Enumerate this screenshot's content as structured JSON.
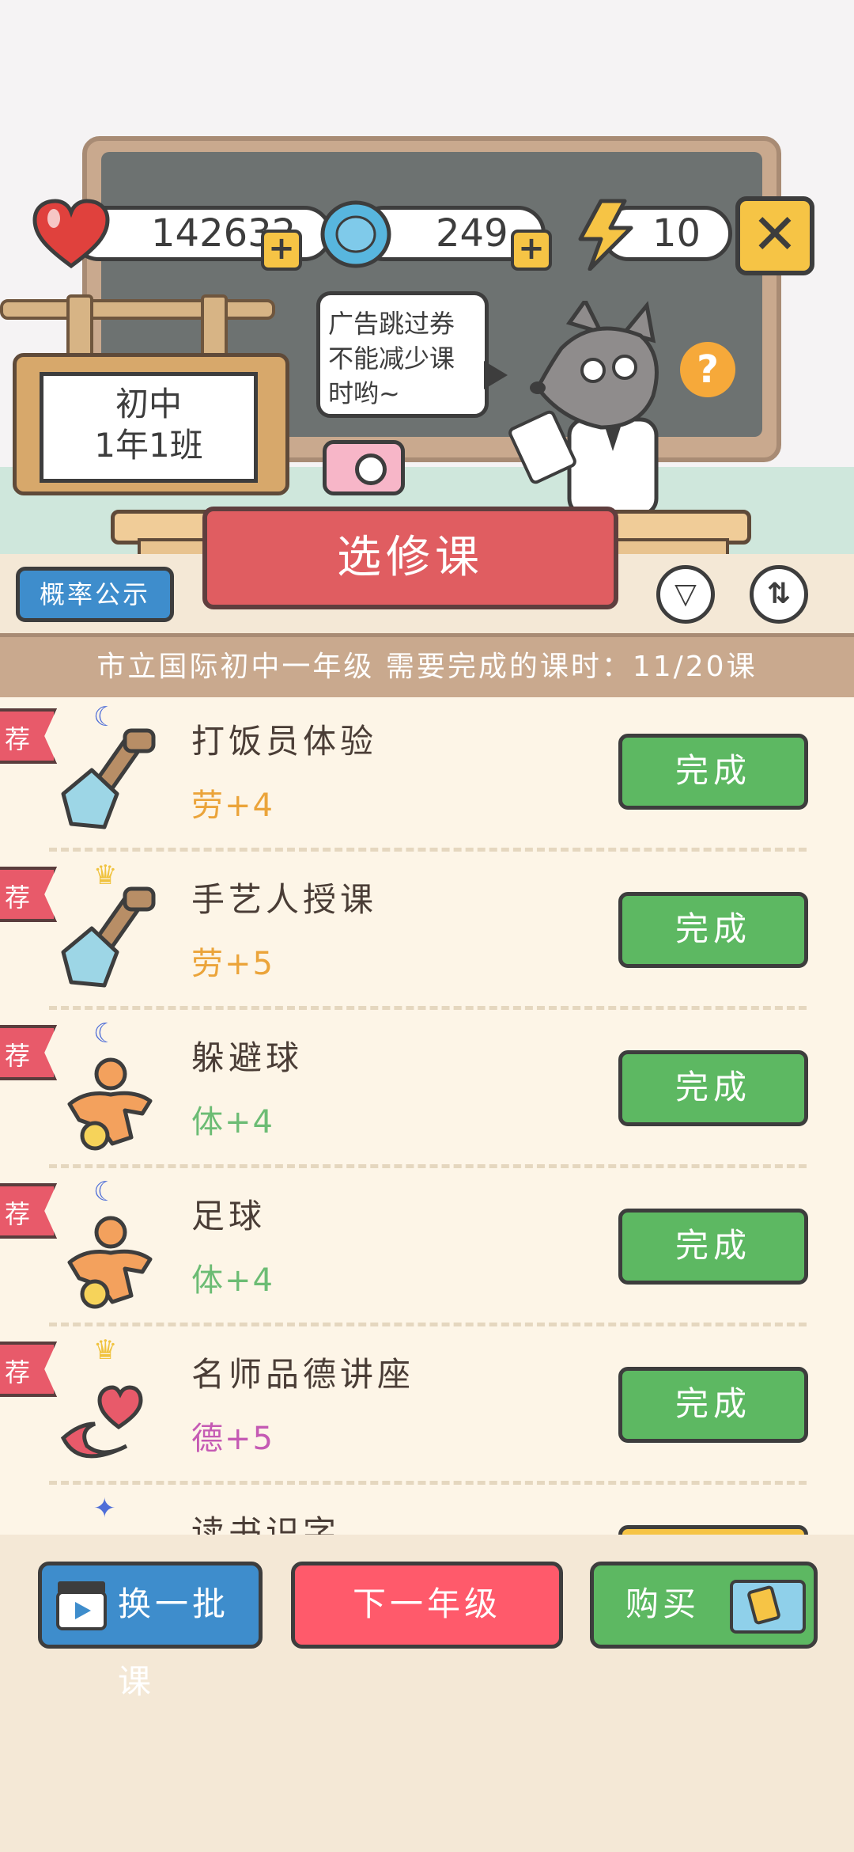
{
  "stats": {
    "hearts": "142632",
    "coins": "249",
    "energy": "10"
  },
  "sign": {
    "line1": "初中",
    "line2": "1年1班"
  },
  "speech_bubble": {
    "line1": "广告跳过券",
    "line2": "不能减少课",
    "line3": "时哟~"
  },
  "help_label": "?",
  "close_label": "✕",
  "title": "选修课",
  "probability_button": "概率公示",
  "filter_icon": "▽",
  "sort_icon": "⇅",
  "header_text": "市立国际初中一年级  需要完成的课时：11/20课",
  "recommend_tag": "荐",
  "courses": [
    {
      "name": "打饭员体验",
      "reward": "劳+4",
      "reward_color": "#eba43a",
      "icon": "shovel-icon",
      "badge": "moon-icon",
      "button": "完成"
    },
    {
      "name": "手艺人授课",
      "reward": "劳+5",
      "reward_color": "#eba43a",
      "icon": "shovel-icon",
      "badge": "crown-icon",
      "button": "完成"
    },
    {
      "name": "躲避球",
      "reward": "体+4",
      "reward_color": "#6cbc74",
      "icon": "athlete-icon",
      "badge": "moon-icon",
      "button": "完成"
    },
    {
      "name": "足球",
      "reward": "体+4",
      "reward_color": "#6cbc74",
      "icon": "athlete-icon",
      "badge": "moon-icon",
      "button": "完成"
    },
    {
      "name": "名师品德讲座",
      "reward": "德+5",
      "reward_color": "#c55ab4",
      "icon": "hearts-icon",
      "badge": "crown-icon",
      "button": "完成"
    },
    {
      "name": "读书识字",
      "reward": "",
      "reward_color": "#4a3d36",
      "icon": "book-icon",
      "badge": "star-icon",
      "button": ""
    }
  ],
  "bottom": {
    "refresh_label": "换一批课",
    "next_grade_label": "下一年级",
    "buy_label": "购买"
  },
  "colors": {
    "green_button": "#5db862",
    "red_button": "#ff5a6b",
    "blue_button": "#3e8dcc",
    "yellow_button": "#f6c445"
  }
}
